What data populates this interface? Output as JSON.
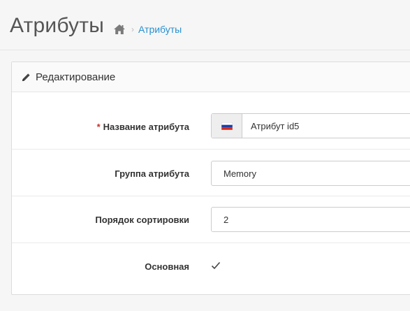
{
  "header": {
    "title": "Атрибуты",
    "breadcrumb": {
      "home_icon": "home-icon",
      "link_label": "Атрибуты"
    }
  },
  "panel": {
    "heading_icon": "pencil-icon",
    "heading": "Редактирование"
  },
  "form": {
    "name": {
      "required_mark": "*",
      "label": "Название атрибута",
      "flag_icon": "ru-flag-icon",
      "value": "Атрибут id5"
    },
    "group": {
      "label": "Группа атрибута",
      "value": "Memory"
    },
    "sort": {
      "label": "Порядок сортировки",
      "value": "2"
    },
    "main": {
      "label": "Основная",
      "checked": true,
      "check_icon": "check-icon"
    }
  },
  "colors": {
    "link": "#2a90d0",
    "required": "#c9302c",
    "background": "#f6f6f6"
  }
}
